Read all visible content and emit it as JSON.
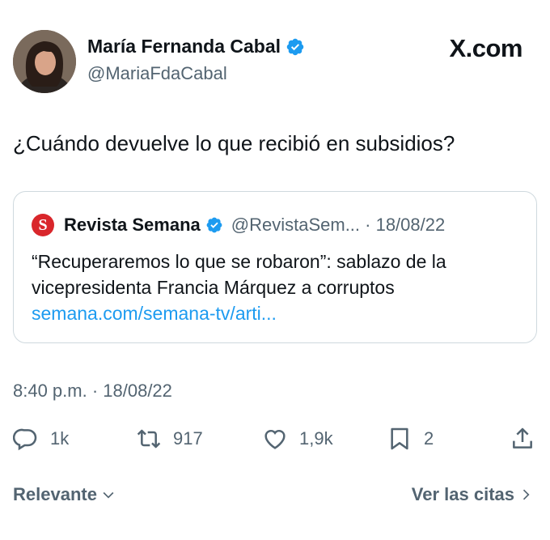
{
  "author": {
    "display_name": "María Fernanda Cabal",
    "handle": "@MariaFdaCabal",
    "verified": true
  },
  "brand": "X.com",
  "tweet": {
    "text": "¿Cuándo devuelve lo que recibió en subsidios?",
    "timestamp": "8:40 p.m. · 18/08/22"
  },
  "quote": {
    "logo_letter": "S",
    "name": "Revista Semana",
    "handle_date": "@RevistaSem... · 18/08/22",
    "text": "“Recuperaremos lo que se robaron”: sablazo de la vicepresidenta Francia Márquez a corruptos",
    "link": "semana.com/semana-tv/arti..."
  },
  "actions": {
    "replies": "1k",
    "retweets": "917",
    "likes": "1,9k",
    "bookmarks": "2"
  },
  "footer": {
    "sort_label": "Relevante",
    "quotes_link": "Ver las citas"
  },
  "colors": {
    "verified": "#1d9bf0",
    "link": "#1d9bf0",
    "muted": "#536471",
    "semana_red": "#d9262b"
  }
}
